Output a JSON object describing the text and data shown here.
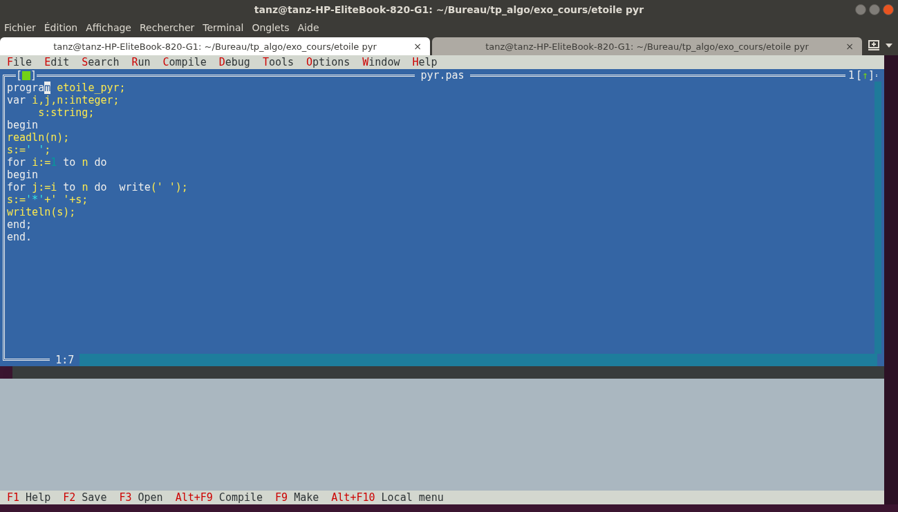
{
  "window": {
    "title": "tanz@tanz-HP-EliteBook-820-G1: ~/Bureau/tp_algo/exo_cours/etoile pyr"
  },
  "menu": [
    "Fichier",
    "Édition",
    "Affichage",
    "Rechercher",
    "Terminal",
    "Onglets",
    "Aide"
  ],
  "tabs": [
    {
      "label": "tanz@tanz-HP-EliteBook-820-G1: ~/Bureau/tp_algo/exo_cours/etoile pyr",
      "selected": true,
      "close": "×"
    },
    {
      "label": "tanz@tanz-HP-EliteBook-820-G1: ~/Bureau/tp_algo/exo_cours/etoile pyr",
      "selected": false,
      "close": "×"
    }
  ],
  "ide_menu": [
    {
      "hotkey": "F",
      "rest": "ile"
    },
    {
      "hotkey": "E",
      "rest": "dit"
    },
    {
      "hotkey": "S",
      "rest": "earch"
    },
    {
      "hotkey": "R",
      "rest": "un"
    },
    {
      "hotkey": "C",
      "rest": "ompile"
    },
    {
      "hotkey": "D",
      "rest": "ebug"
    },
    {
      "hotkey": "T",
      "rest": "ools"
    },
    {
      "hotkey": "O",
      "rest": "ptions"
    },
    {
      "hotkey": "W",
      "rest": "indow"
    },
    {
      "hotkey": "H",
      "rest": "elp"
    }
  ],
  "editor": {
    "title": "pyr.pas",
    "window_number": "1",
    "close_box": {
      "left": "[",
      "right": "]"
    },
    "zoom_button": {
      "left": "[",
      "arrow": "↑",
      "right": "]"
    },
    "position": "1:7",
    "lines": [
      [
        {
          "text": "progra",
          "kind": "keyword"
        },
        {
          "text": "m",
          "kind": "cursor"
        },
        {
          "text": " etoile_pyr;",
          "kind": "ident"
        }
      ],
      [
        {
          "text": "var ",
          "kind": "keyword"
        },
        {
          "text": "i,j,n:integer;",
          "kind": "ident"
        }
      ],
      [
        {
          "text": "     s:string;",
          "kind": "ident"
        }
      ],
      [
        {
          "text": "begin",
          "kind": "keyword"
        }
      ],
      [
        {
          "text": "readln(n);",
          "kind": "ident"
        }
      ],
      [
        {
          "text": "s:=",
          "kind": "ident"
        },
        {
          "text": "' '",
          "kind": "string"
        },
        {
          "text": ";",
          "kind": "ident"
        }
      ],
      [
        {
          "text": "for ",
          "kind": "keyword"
        },
        {
          "text": "i:=",
          "kind": "ident"
        },
        {
          "text": "1",
          "kind": "number"
        },
        {
          "text": " to ",
          "kind": "keyword"
        },
        {
          "text": "n",
          "kind": "ident"
        },
        {
          "text": " do",
          "kind": "keyword"
        }
      ],
      [
        {
          "text": "begin",
          "kind": "keyword"
        }
      ],
      [
        {
          "text": "for ",
          "kind": "keyword"
        },
        {
          "text": "j:=i",
          "kind": "ident"
        },
        {
          "text": " to ",
          "kind": "keyword"
        },
        {
          "text": "n",
          "kind": "ident"
        },
        {
          "text": " do  write",
          "kind": "keyword"
        },
        {
          "text": "(' ');",
          "kind": "ident"
        }
      ],
      [
        {
          "text": "s:=",
          "kind": "ident"
        },
        {
          "text": "'*'",
          "kind": "string"
        },
        {
          "text": "+' '+s;",
          "kind": "ident"
        }
      ],
      [
        {
          "text": "writeln(s);",
          "kind": "ident"
        }
      ],
      [
        {
          "text": "end;",
          "kind": "keyword"
        }
      ],
      [
        {
          "text": "end.",
          "kind": "keyword"
        }
      ]
    ]
  },
  "status_bar": [
    {
      "key": "F1",
      "label": "Help"
    },
    {
      "key": "F2",
      "label": "Save"
    },
    {
      "key": "F3",
      "label": "Open"
    },
    {
      "key": "Alt+F9",
      "label": "Compile"
    },
    {
      "key": "F9",
      "label": "Make"
    },
    {
      "key": "Alt+F10",
      "label": "Local menu"
    }
  ]
}
